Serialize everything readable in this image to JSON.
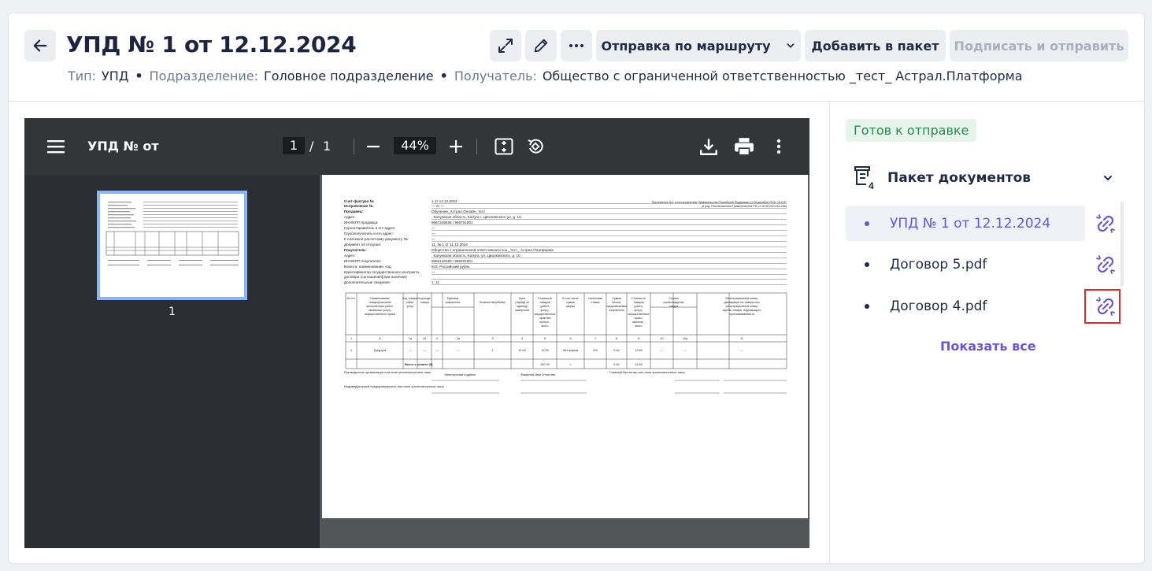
{
  "header": {
    "title": "УПД № 1 от 12.12.2024",
    "meta": {
      "type_label": "Тип:",
      "type_value": "УПД",
      "division_label": "Подразделение:",
      "division_value": "Головное подразделение",
      "recipient_label": "Получатель:",
      "recipient_value": "Общество с ограниченной ответственностью _тест_ Астрал.Платформа"
    },
    "actions": {
      "route_label": "Отправка по маршруту",
      "add_to_package_label": "Добавить в пакет",
      "sign_send_label": "Подписать и отправить"
    }
  },
  "viewer": {
    "title": "УПД № от",
    "page_current": "1",
    "page_separator": "/",
    "page_total": "1",
    "zoom": "44%",
    "thumb_number": "1"
  },
  "document": {
    "lines_left": [
      "Счет-фактура №",
      "Исправление №",
      "Продавец:",
      "Адрес:",
      "ИНН/КПП продавца:",
      "Грузоотправитель и его адрес:",
      "Грузополучатель и его адрес:",
      "К платежно-расчетному документу №:",
      "Документ об отгрузке:",
      "Покупатель:",
      "Адрес:",
      "ИНН/КПП покупателя:",
      "Валюта: наименование, код:",
      "Идентификатор государственного контракта,",
      "договора (соглашения)(при наличии):",
      "Дополнительные сведения:"
    ],
    "lines_right": [
      "1 от 12.12.2024",
      "— от —",
      "Обучение_Астрал.Онлайн_тест",
      ", Калужская область, Калуга г, Циолковского ул, д. 10",
      "9667246536 / 966701001",
      "—",
      "—",
      "—",
      "11, № 1 от 11.12.2024",
      "Общество с ограниченной ответственностью _тест_ Астрал.Платформа",
      ", Калужская область, Калуга, ул. Циолковского, д. 10",
      "9652148180 / 965201001",
      "643, Российский рубль",
      "—",
      "",
      "1: 11"
    ],
    "decree_line1": "Приложение №1 к постановлению Правительства Российской Федерации от 26 декабря 2011г. №1137",
    "decree_line2": "(в ред. Постановления Правительства РФ от 16.08.2024 №1096)",
    "table_header": [
      "№ п/ п",
      "Наименование товара(описание выполненных работ, оказанных услуг), имущественного права",
      "Код товара/ работ, услуг",
      "Код вида товара",
      "Единица измерения",
      "Количество(объём)",
      "Цена (тариф) за единицу измерения",
      "Стоимость товаров (работ, услуг), имущественных прав без налога - всего",
      "В том числе сумма акциза",
      "Налоговая ставка",
      "Сумма налога, предъявляемая покупателю",
      "Стоимость товаров (работ, услуг), имущественных прав с налогом - всего",
      "Страна происхождения товара",
      "Регистрационный номер декларации на товары или регистрационный номер партии товара, подлежащего прослеживаемости"
    ],
    "table_numbers": [
      "1",
      "А",
      "1а",
      "1б",
      "2",
      "2а",
      "3",
      "4",
      "5",
      "6",
      "7",
      "8",
      "9",
      "10",
      "10а",
      "11"
    ],
    "row": [
      "1",
      "Кукуруза",
      "—",
      "—",
      "—",
      "—",
      "1",
      "12.00",
      "12.00",
      "без акциза",
      "5%",
      "0.60",
      "12.60",
      "—",
      "—",
      "—"
    ],
    "total_label": "Всего к оплате (9)",
    "total_values": [
      "100.00",
      "×",
      "0.60",
      "12.60"
    ],
    "sign_head": "Руководитель организации или иное уполномоченное лицо",
    "sign_epod": "Электронная подпись",
    "sign_fio": "Фамилия Имя Отчество",
    "sign_chief": "Главный бухгалтер или иное уполномоченное лицо",
    "sign_ip": "Индивидуальный предприниматель или иное уполномоченное лицо"
  },
  "panel": {
    "status": "Готов к отправке",
    "package_title": "Пакет документов",
    "package_count": "4",
    "items": [
      {
        "label": "УПД № 1 от 12.12.2024"
      },
      {
        "label": "Договор 5.pdf"
      },
      {
        "label": "Договор 4.pdf"
      }
    ],
    "show_all": "Показать все"
  },
  "colors": {
    "accent": "#6a55d8",
    "status_green": "#2a8a4e",
    "highlight_red": "#e8262b"
  },
  "icons": {
    "back": "arrow-left-icon",
    "expand": "expand-icon",
    "edit": "pencil-icon",
    "more": "more-horizontal-icon",
    "route_chevron": "chevron-down-icon",
    "menu": "menu-icon",
    "download": "download-icon",
    "print": "print-icon",
    "viewer_more": "more-vertical-icon",
    "fit_page": "fit-page-icon",
    "rotate": "rotate-icon",
    "package": "package-icon",
    "link": "link-icon"
  }
}
